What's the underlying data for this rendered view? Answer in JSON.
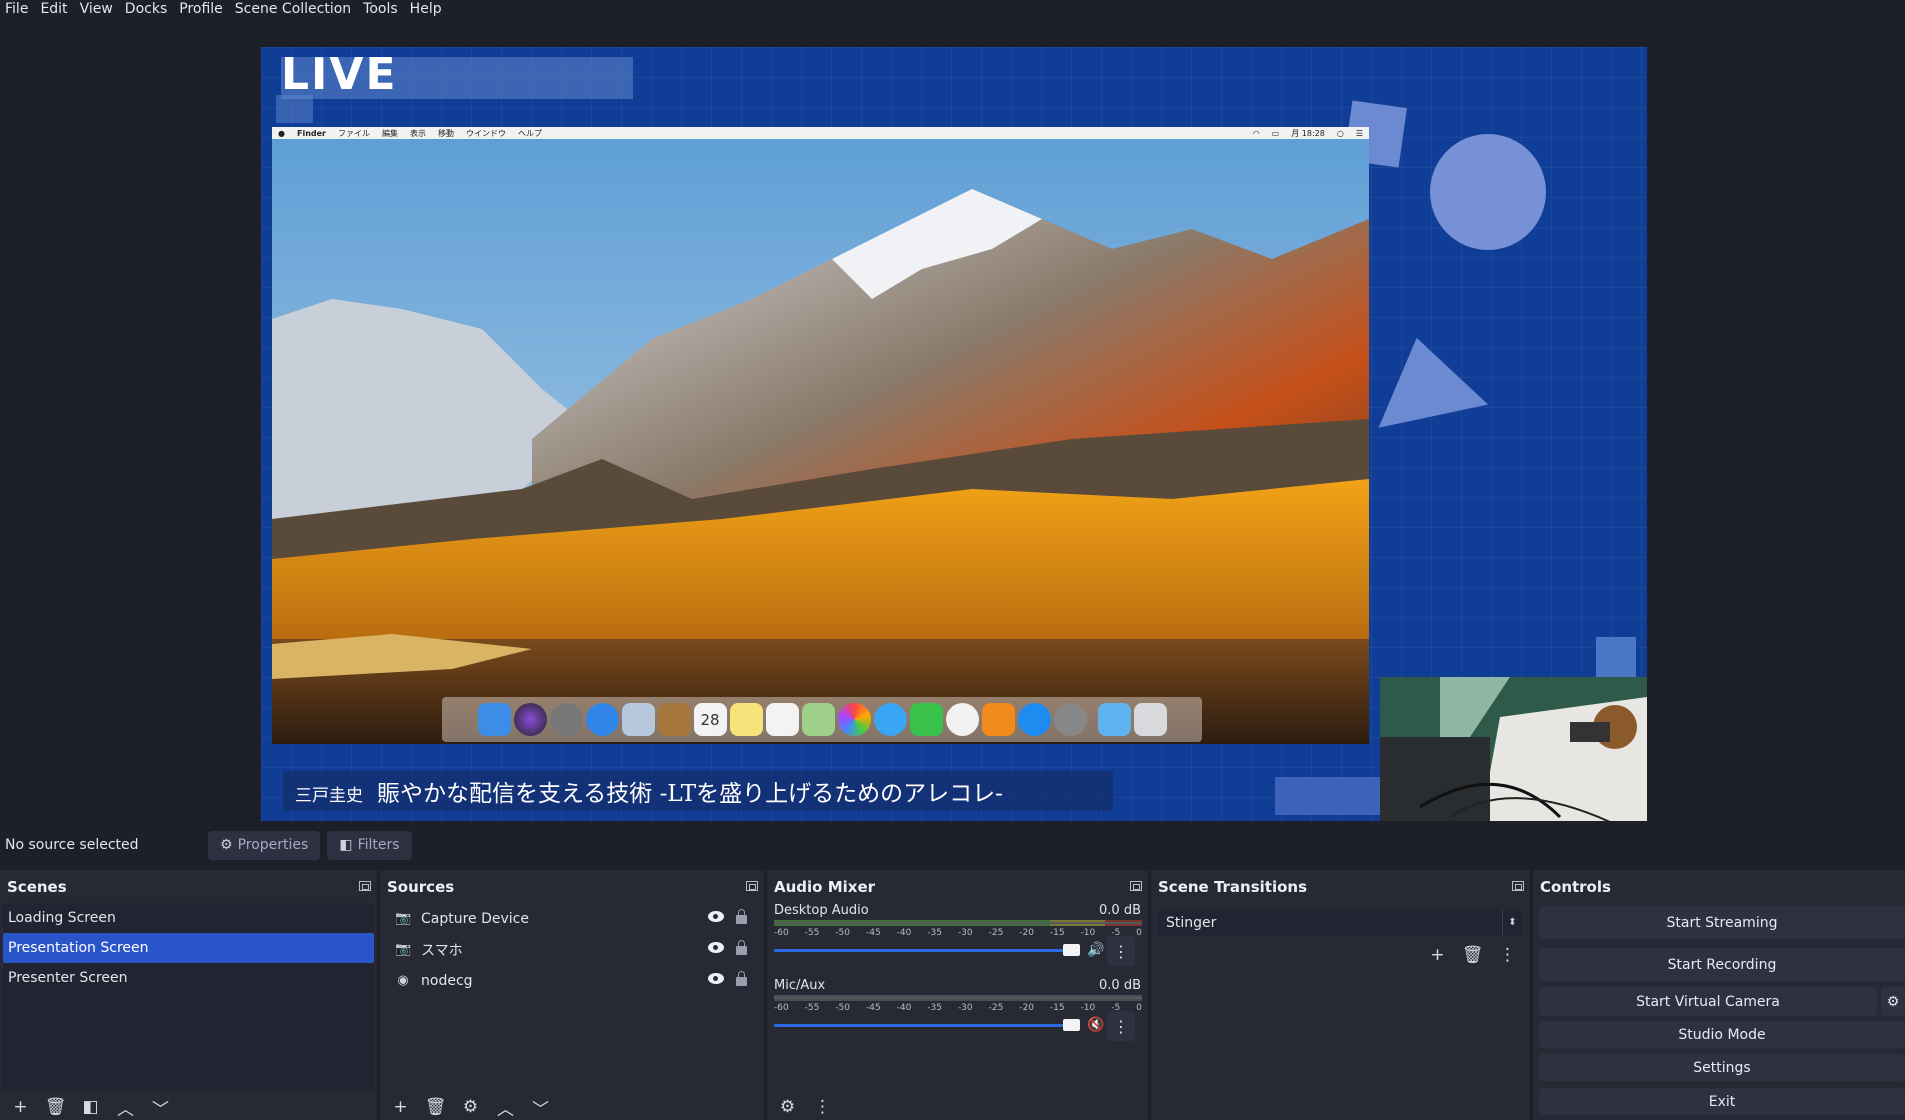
{
  "menubar": {
    "items": [
      "File",
      "Edit",
      "View",
      "Docks",
      "Profile",
      "Scene Collection",
      "Tools",
      "Help"
    ]
  },
  "preview": {
    "live_label": "LIVE",
    "mac_menubar": {
      "items": [
        "Finder",
        "ファイル",
        "編集",
        "表示",
        "移動",
        "ウインドウ",
        "ヘルプ"
      ],
      "clock": "月 18:28"
    },
    "dock_date": "28",
    "lower_third": {
      "name": "三戸圭史",
      "title": "賑やかな配信を支える技術 -LTを盛り上げるためのアレコレ-"
    }
  },
  "status_row": {
    "no_source": "No source selected",
    "properties": "Properties",
    "filters": "Filters"
  },
  "scenes": {
    "title": "Scenes",
    "items": [
      {
        "label": "Loading Screen",
        "selected": false
      },
      {
        "label": "Presentation Screen",
        "selected": true
      },
      {
        "label": "Presenter Screen",
        "selected": false
      }
    ]
  },
  "sources": {
    "title": "Sources",
    "items": [
      {
        "label": "Capture Device",
        "icon": "camera-icon"
      },
      {
        "label": "スマホ",
        "icon": "camera-icon"
      },
      {
        "label": "nodecg",
        "icon": "globe-icon"
      }
    ]
  },
  "audio_mixer": {
    "title": "Audio Mixer",
    "channels": [
      {
        "name": "Desktop Audio",
        "db": "0.0 dB",
        "volume": 1.0,
        "muted": false
      },
      {
        "name": "Mic/Aux",
        "db": "0.0 dB",
        "volume": 1.0,
        "muted": true
      }
    ],
    "ticks": [
      "-60",
      "-55",
      "-50",
      "-45",
      "-40",
      "-35",
      "-30",
      "-25",
      "-20",
      "-15",
      "-10",
      "-5",
      "0"
    ]
  },
  "scene_transitions": {
    "title": "Scene Transitions",
    "selected": "Stinger"
  },
  "controls": {
    "title": "Controls",
    "buttons": {
      "start_streaming": "Start Streaming",
      "start_recording": "Start Recording",
      "start_virtual_camera": "Start Virtual Camera",
      "studio_mode": "Studio Mode",
      "settings": "Settings",
      "exit": "Exit"
    }
  },
  "colors": {
    "canvas_bg": "#103d95",
    "selection": "#2a55c9",
    "panel_bg": "#272a35",
    "app_bg": "#1d1f29"
  }
}
